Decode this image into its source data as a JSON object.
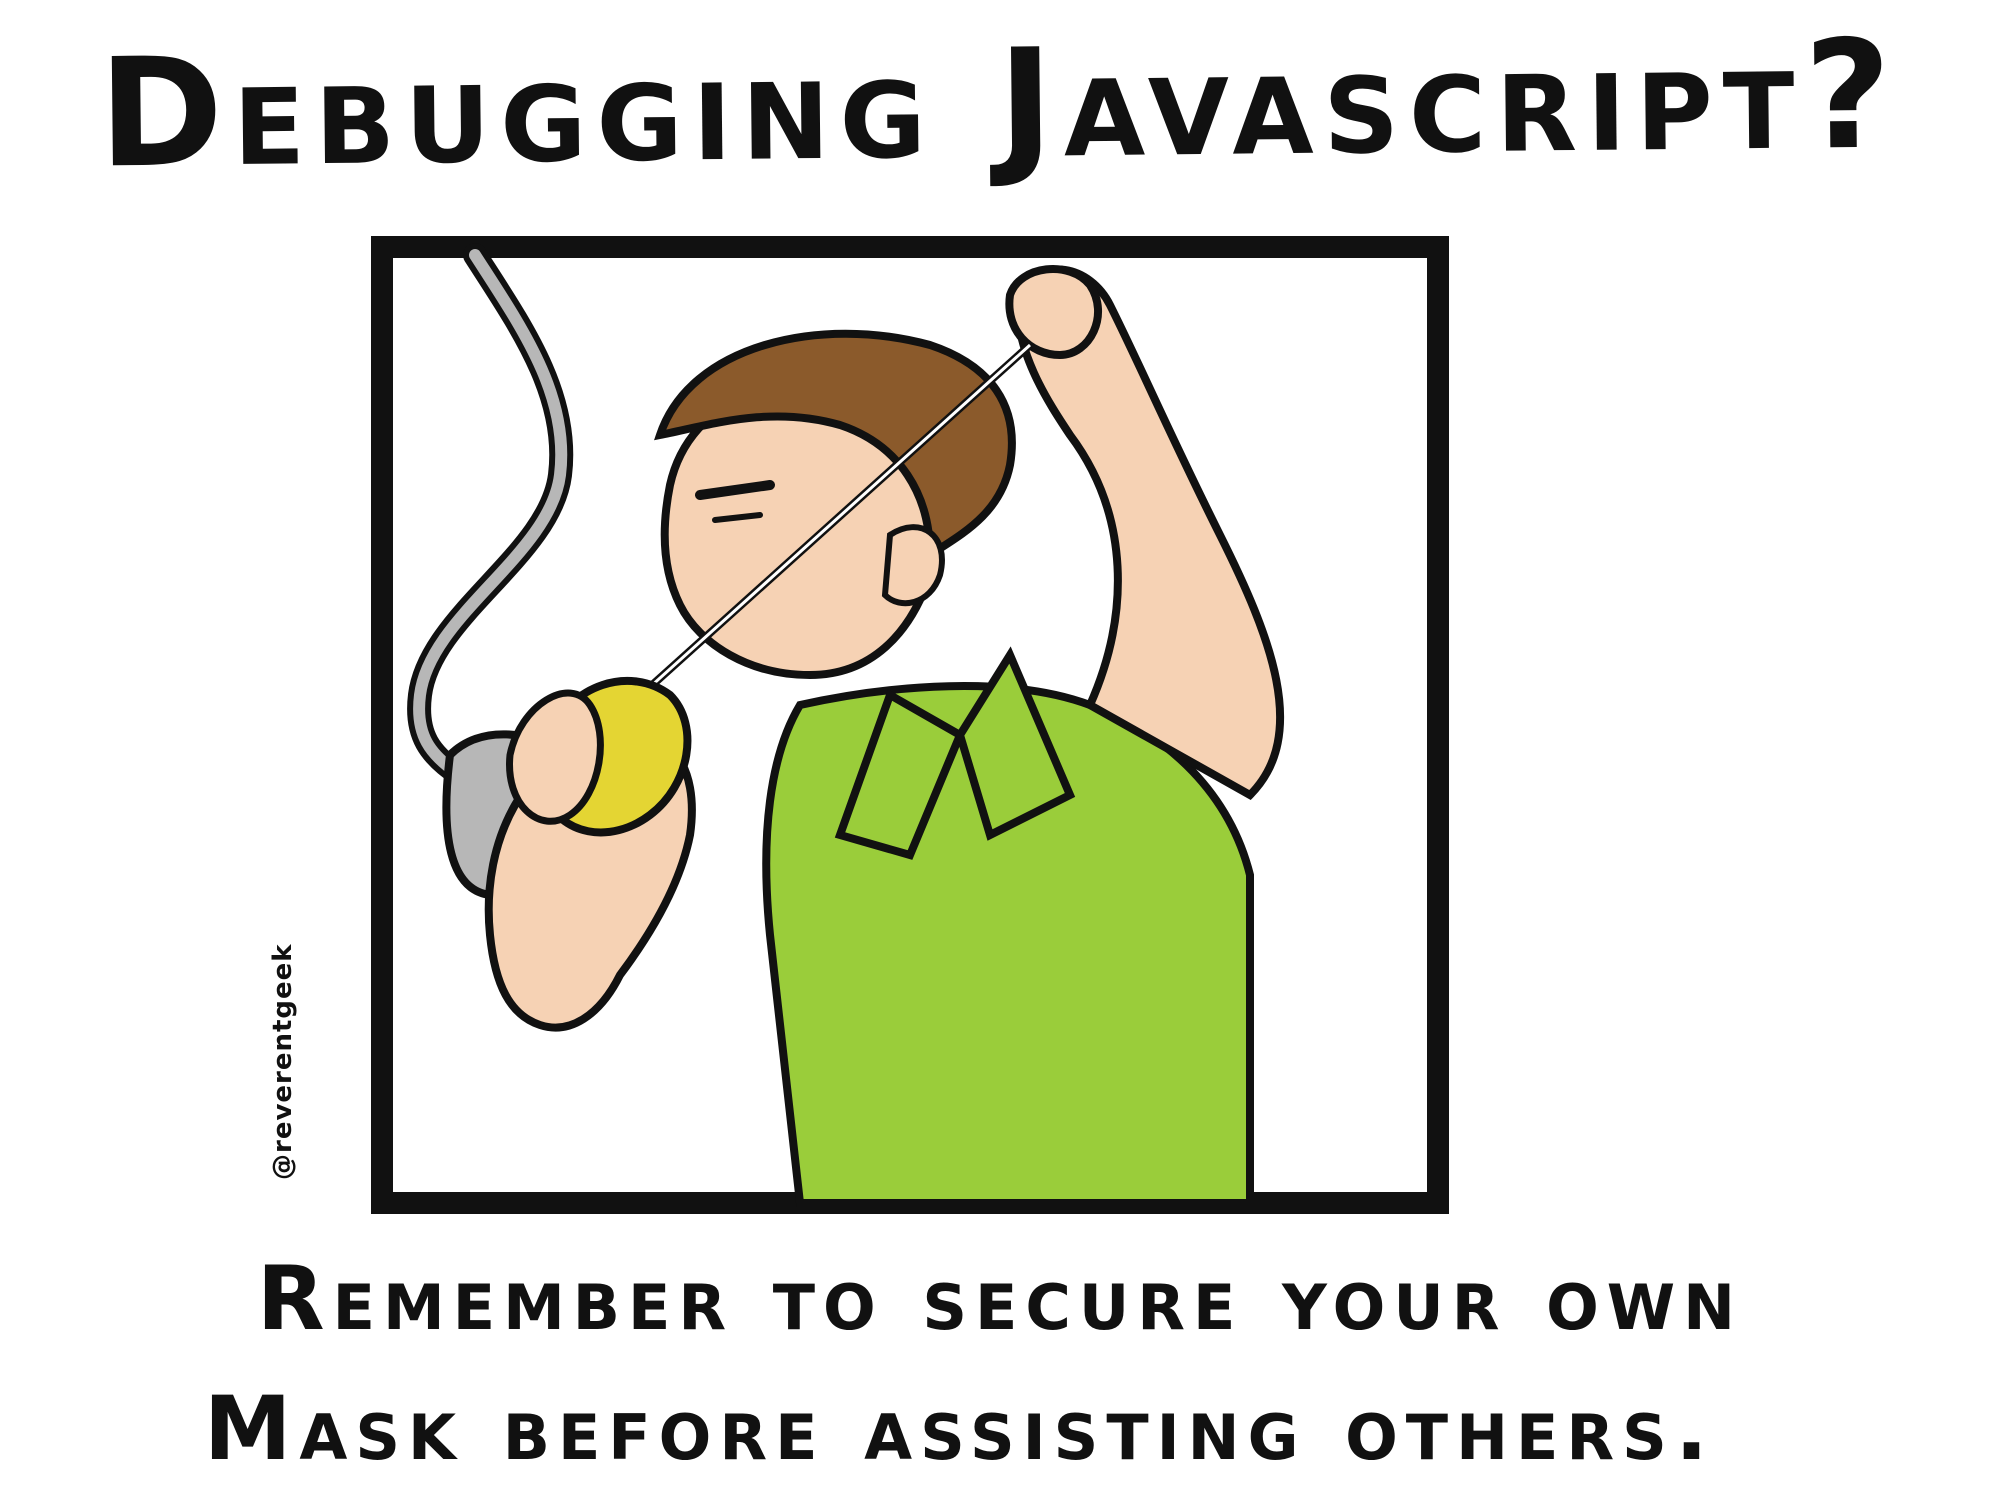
{
  "title": "Debugging Javascript?",
  "caption": {
    "line1": "Remember to secure your own",
    "line2": "Mask before assisting others."
  },
  "signature": "@reverentgeek",
  "colors": {
    "shirt": "#9ACD3A",
    "hair": "#8B5A2B",
    "skin": "#F6D2B4",
    "mask": "#E4D533",
    "other_mask": "#B7B7B7",
    "outline": "#111111"
  }
}
